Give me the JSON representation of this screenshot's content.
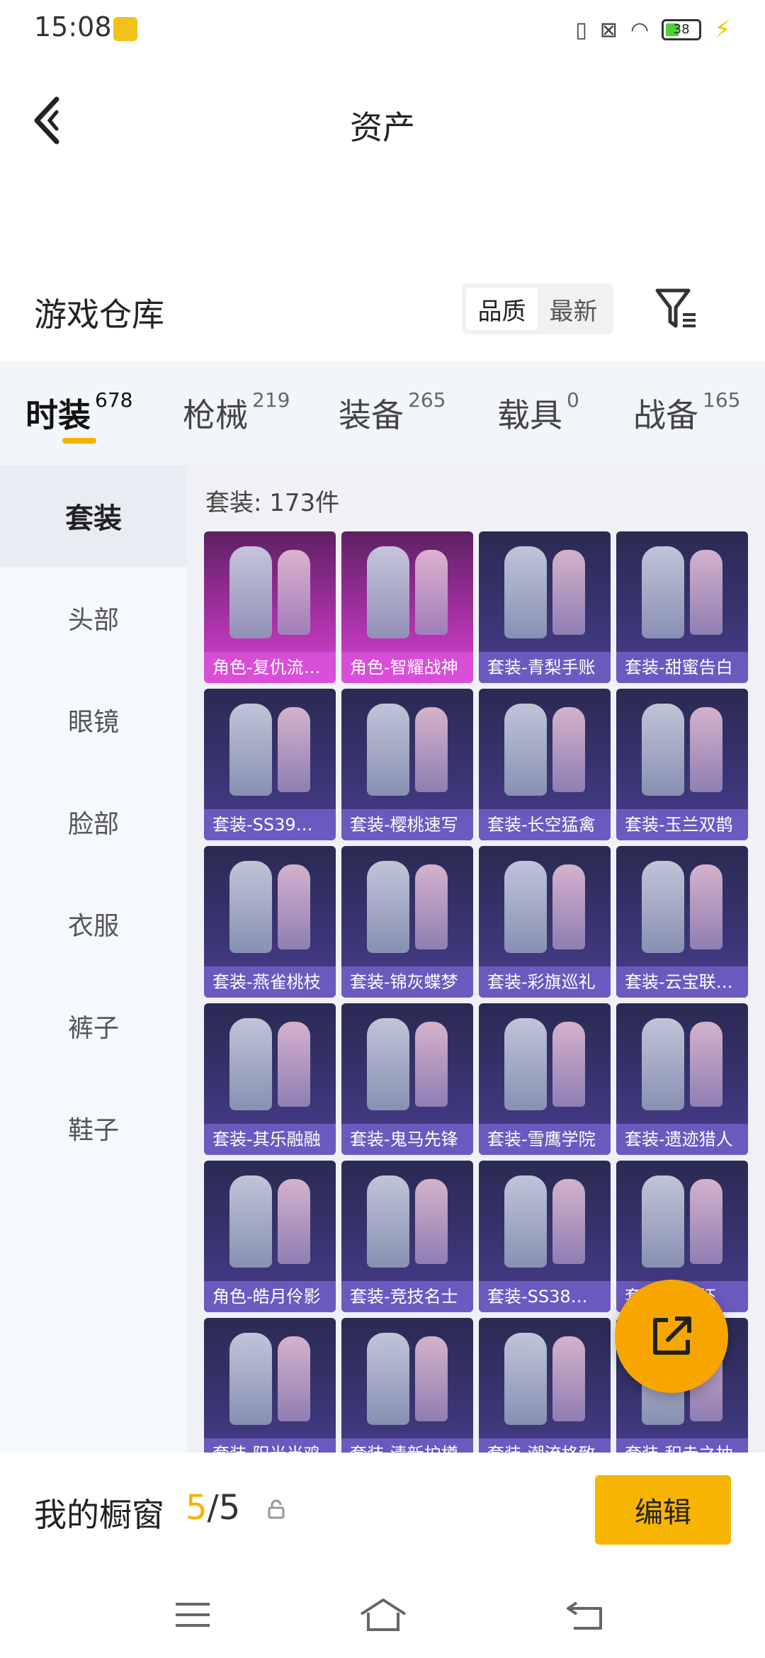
{
  "status": {
    "time": "15:08",
    "battery": "38"
  },
  "header": {
    "title": "资产"
  },
  "warehouse": {
    "title": "游戏仓库",
    "sort_options": [
      "品质",
      "最新"
    ]
  },
  "tabs": [
    {
      "label": "时装",
      "count": "678"
    },
    {
      "label": "枪械",
      "count": "219"
    },
    {
      "label": "装备",
      "count": "265"
    },
    {
      "label": "载具",
      "count": "0"
    },
    {
      "label": "战备",
      "count": "165"
    }
  ],
  "sidebar": {
    "items": [
      "套装",
      "头部",
      "眼镜",
      "脸部",
      "衣服",
      "裤子",
      "鞋子"
    ]
  },
  "content": {
    "count_label": "套装: 173件",
    "items": [
      {
        "name": "角色-复仇流…",
        "style": "pink"
      },
      {
        "name": "角色-智耀战神",
        "style": "pink"
      },
      {
        "name": "套装-青梨手账",
        "style": "purple"
      },
      {
        "name": "套装-甜蜜告白",
        "style": "purple"
      },
      {
        "name": "套装-SS39…",
        "style": "purple"
      },
      {
        "name": "套装-樱桃速写",
        "style": "purple"
      },
      {
        "name": "套装-长空猛禽",
        "style": "purple"
      },
      {
        "name": "套装-玉兰双鹊",
        "style": "purple"
      },
      {
        "name": "套装-燕雀桃枝",
        "style": "purple"
      },
      {
        "name": "套装-锦灰蝶梦",
        "style": "purple"
      },
      {
        "name": "套装-彩旗巡礼",
        "style": "purple"
      },
      {
        "name": "套装-云宝联…",
        "style": "purple"
      },
      {
        "name": "套装-其乐融融",
        "style": "purple"
      },
      {
        "name": "套装-鬼马先锋",
        "style": "purple"
      },
      {
        "name": "套装-雪鹰学院",
        "style": "purple"
      },
      {
        "name": "套装-遗迹猎人",
        "style": "purple"
      },
      {
        "name": "角色-皓月伶影",
        "style": "purple"
      },
      {
        "name": "套装-竞技名士",
        "style": "purple"
      },
      {
        "name": "套装-SS38…",
        "style": "purple"
      },
      {
        "name": "套装-…龙虾",
        "style": "purple"
      },
      {
        "name": "套装-阳光当鸡",
        "style": "purple"
      },
      {
        "name": "套装-清新护樽",
        "style": "purple"
      },
      {
        "name": "套装-潮流格致",
        "style": "purple"
      },
      {
        "name": "套装-积赤之抽",
        "style": "purple"
      }
    ]
  },
  "showcase": {
    "title": "我的橱窗",
    "current": "5",
    "total": "/5",
    "edit_label": "编辑"
  },
  "icons": [
    "back-arrow-icon",
    "filter-icon",
    "share-icon",
    "lock-icon",
    "menu-icon",
    "home-icon",
    "back-icon"
  ],
  "colors": {
    "accent": "#f5b300",
    "card_purple": "#3a3575",
    "card_pink": "#b735b4"
  }
}
